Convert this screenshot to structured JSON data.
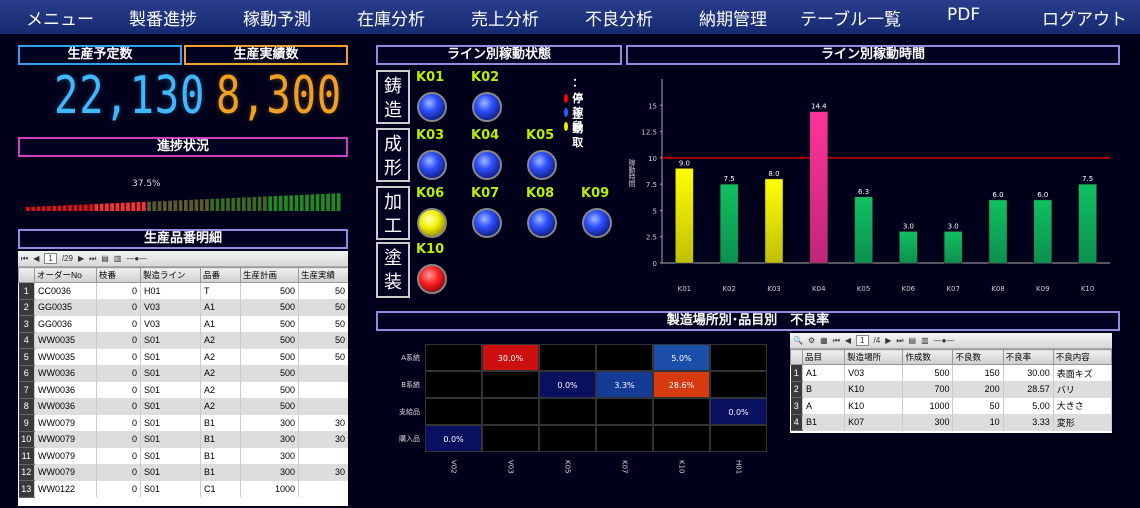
{
  "menu": [
    "メニュー",
    "製番進捗",
    "稼動予測",
    "在庫分析",
    "売上分析",
    "不良分析",
    "納期管理",
    "テーブル一覧",
    "PDF",
    "ログアウト"
  ],
  "counters": {
    "planned_title": "生産予定数",
    "planned_value": "22,130",
    "actual_title": "生産実績数",
    "actual_value": "8,300"
  },
  "progress": {
    "title": "進捗状況",
    "label": "37.5%",
    "fraction": 0.375
  },
  "detail_grid": {
    "title": "生産品番明細",
    "page_current": "1",
    "page_total": "/29",
    "columns": [
      "オーダーNo",
      "枝番",
      "製造ライン",
      "品番",
      "生産計画",
      "生産実績"
    ],
    "rows": [
      [
        "1",
        "CC0036",
        "0",
        "H01",
        "T",
        "500",
        "50"
      ],
      [
        "2",
        "GG0035",
        "0",
        "V03",
        "A1",
        "500",
        "50"
      ],
      [
        "3",
        "GG0036",
        "0",
        "V03",
        "A1",
        "500",
        "50"
      ],
      [
        "4",
        "WW0035",
        "0",
        "S01",
        "A2",
        "500",
        "50"
      ],
      [
        "5",
        "WW0035",
        "0",
        "S01",
        "A2",
        "500",
        "50"
      ],
      [
        "6",
        "WW0036",
        "0",
        "S01",
        "A2",
        "500",
        ""
      ],
      [
        "7",
        "WW0036",
        "0",
        "S01",
        "A2",
        "500",
        ""
      ],
      [
        "8",
        "WW0036",
        "0",
        "S01",
        "A2",
        "500",
        ""
      ],
      [
        "9",
        "WW0079",
        "0",
        "S01",
        "B1",
        "300",
        "30"
      ],
      [
        "10",
        "WW0079",
        "0",
        "S01",
        "B1",
        "300",
        "30"
      ],
      [
        "11",
        "WW0079",
        "0",
        "S01",
        "B1",
        "300",
        ""
      ],
      [
        "12",
        "WW0079",
        "0",
        "S01",
        "B1",
        "300",
        "30"
      ],
      [
        "13",
        "WW0122",
        "0",
        "S01",
        "C1",
        "1000",
        ""
      ]
    ]
  },
  "line_status": {
    "title": "ライン別稼動状態",
    "legend": [
      {
        "color": "#ff0000",
        "label": "：停止"
      },
      {
        "color": "#2060ff",
        "label": "：稼動"
      },
      {
        "color": "#f0f000",
        "label": "：段取"
      }
    ],
    "sections": [
      {
        "label": "鋳造",
        "lines": [
          {
            "id": "K01",
            "state": "run"
          },
          {
            "id": "K02",
            "state": "run"
          }
        ]
      },
      {
        "label": "成形",
        "lines": [
          {
            "id": "K03",
            "state": "run"
          },
          {
            "id": "K04",
            "state": "run"
          },
          {
            "id": "K05",
            "state": "run"
          }
        ]
      },
      {
        "label": "加工",
        "lines": [
          {
            "id": "K06",
            "state": "setup"
          },
          {
            "id": "K07",
            "state": "run"
          },
          {
            "id": "K08",
            "state": "run"
          },
          {
            "id": "K09",
            "state": "run"
          }
        ]
      },
      {
        "label": "塗装",
        "lines": [
          {
            "id": "K10",
            "state": "stop"
          }
        ]
      }
    ]
  },
  "chart_title": "ライン別稼動時間",
  "chart_data": {
    "type": "bar",
    "categories": [
      "K01",
      "K02",
      "K03",
      "K04",
      "K05",
      "K06",
      "K07",
      "K08",
      "K09",
      "K10"
    ],
    "values": [
      9.0,
      7.5,
      8.0,
      14.4,
      6.3,
      3.0,
      3.0,
      6.0,
      6.0,
      7.5
    ],
    "value_labels": [
      "9.0",
      "7.5",
      "8.0",
      "14.4",
      "6.3",
      "3.0",
      "3.0",
      "6.0",
      "6.0",
      "7.5"
    ],
    "bar_colors": [
      "#ffff00",
      "#10c060",
      "#ffff00",
      "#ff3399",
      "#10c060",
      "#10c060",
      "#10c060",
      "#10c060",
      "#10c060",
      "#10c060"
    ],
    "ylabel": "稼動時間",
    "ylim": [
      0,
      17.5
    ],
    "yticks": [
      0,
      2.5,
      5,
      7.5,
      10,
      12.5,
      15
    ],
    "ytick_labels": [
      "0",
      "2.5",
      "5",
      "7.5",
      "10",
      "12.5",
      "15"
    ],
    "reference_line": 10,
    "reference_color": "#cc0000",
    "grid": false
  },
  "defect": {
    "title": "製造場所別･品目別　不良率",
    "heatmap": {
      "rows": [
        "A系統",
        "B系統",
        "支給品",
        "購入品"
      ],
      "cols": [
        "V02",
        "V03",
        "K05",
        "K07",
        "K10",
        "H01"
      ],
      "cells": [
        {
          "r": 0,
          "c": 1,
          "label": "30.0%",
          "color": "#cc1010"
        },
        {
          "r": 0,
          "c": 4,
          "label": "5.0%",
          "color": "#1a4ea8"
        },
        {
          "r": 1,
          "c": 2,
          "label": "0.0%",
          "color": "#0a1060"
        },
        {
          "r": 1,
          "c": 3,
          "label": "3.3%",
          "color": "#143c96"
        },
        {
          "r": 1,
          "c": 4,
          "label": "28.6%",
          "color": "#d83a10"
        },
        {
          "r": 2,
          "c": 5,
          "label": "0.0%",
          "color": "#0a1060"
        },
        {
          "r": 3,
          "c": 0,
          "label": "0.0%",
          "color": "#0a1060"
        }
      ]
    },
    "grid": {
      "page_current": "1",
      "page_total": "/4",
      "columns": [
        "品目",
        "製造場所",
        "作成数",
        "不良数",
        "不良率",
        "不良内容"
      ],
      "rows": [
        [
          "1",
          "A1",
          "V03",
          "500",
          "150",
          "30.00",
          "表面キズ"
        ],
        [
          "2",
          "B",
          "K10",
          "700",
          "200",
          "28.57",
          "バリ"
        ],
        [
          "3",
          "A",
          "K10",
          "1000",
          "50",
          "5.00",
          "大きさ"
        ],
        [
          "4",
          "B1",
          "K07",
          "300",
          "10",
          "3.33",
          "変形"
        ]
      ]
    }
  }
}
